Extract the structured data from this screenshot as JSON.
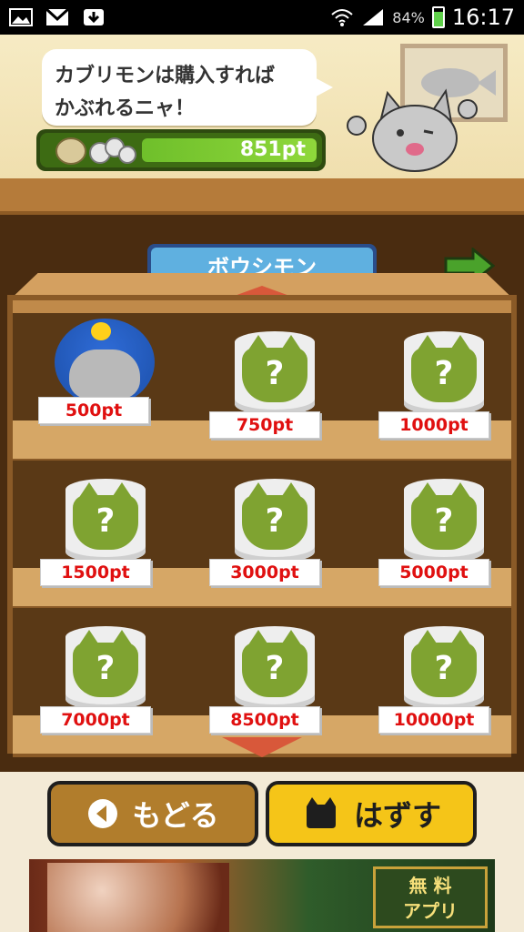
{
  "status_bar": {
    "battery_percent": "84%",
    "time": "16:17",
    "icons": [
      "image-icon",
      "gmail-icon",
      "download-icon",
      "wifi-icon",
      "signal-icon",
      "battery-icon"
    ]
  },
  "header": {
    "speech": [
      "カブリモンは購入すれば",
      "かぶれるニャ！"
    ],
    "points": "851pt"
  },
  "category": {
    "title": "ボウシモン"
  },
  "shelf": {
    "rows": [
      [
        {
          "price": "500pt",
          "owned": true
        },
        {
          "price": "750pt",
          "owned": false
        },
        {
          "price": "1000pt",
          "owned": false
        }
      ],
      [
        {
          "price": "1500pt",
          "owned": false
        },
        {
          "price": "3000pt",
          "owned": false
        },
        {
          "price": "5000pt",
          "owned": false
        }
      ],
      [
        {
          "price": "7000pt",
          "owned": false
        },
        {
          "price": "8500pt",
          "owned": false
        },
        {
          "price": "10000pt",
          "owned": false
        }
      ]
    ],
    "unknown_mark": "?"
  },
  "buttons": {
    "back": "もどる",
    "remove": "はずす"
  },
  "ad": {
    "badge_line1": "無 料",
    "badge_line2": "アプリ"
  },
  "colors": {
    "price_red": "#e01010",
    "can_green": "#7fa331",
    "remove_yellow": "#f5c518",
    "back_brown": "#b17d2c"
  }
}
